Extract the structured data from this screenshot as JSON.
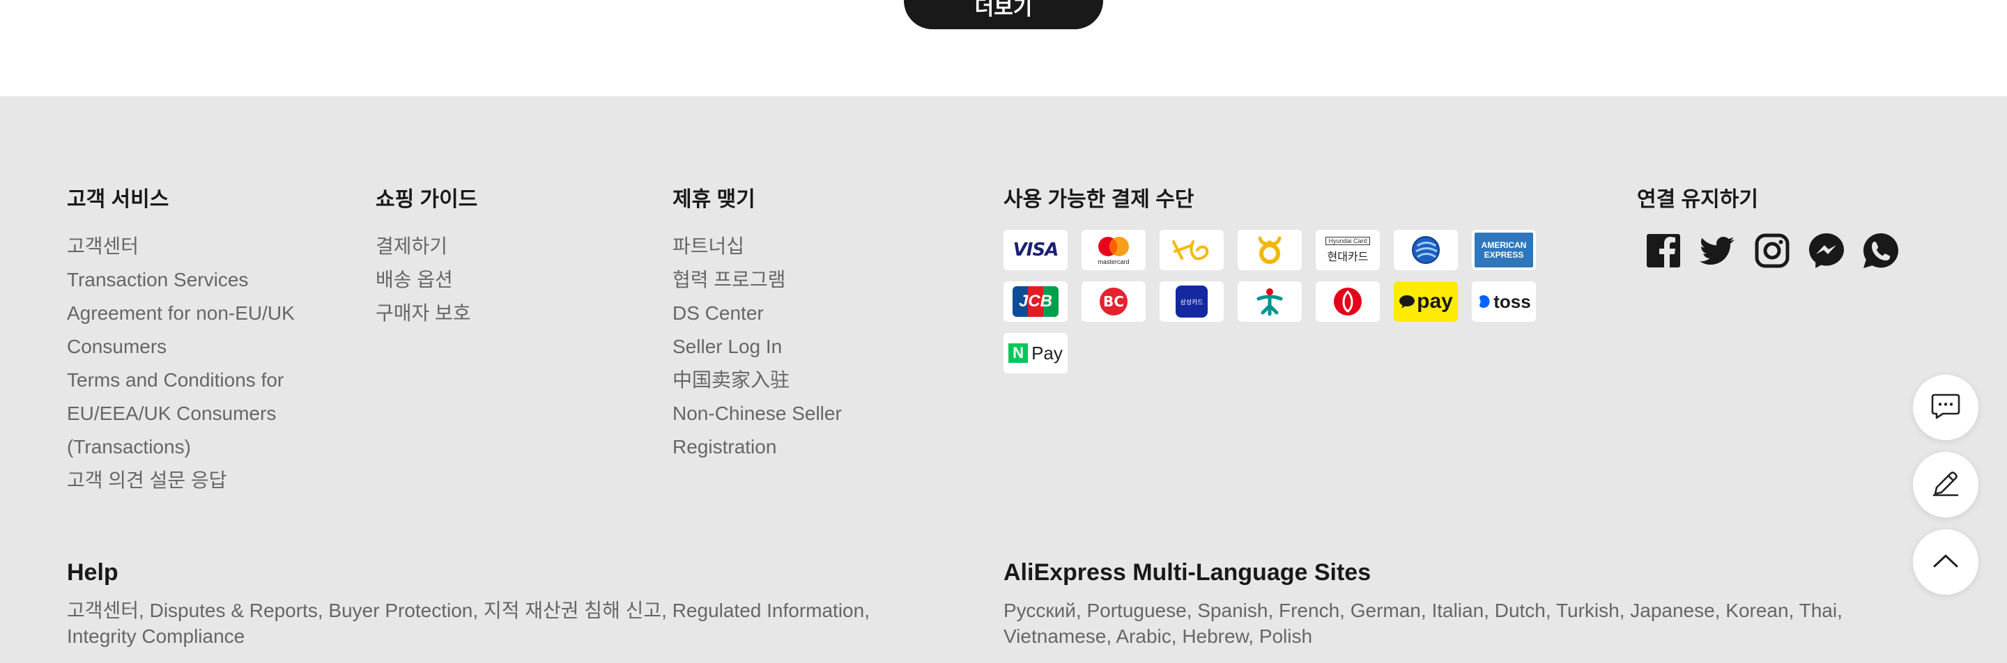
{
  "top": {
    "more_label": "더보기"
  },
  "customer_service": {
    "title": "고객 서비스",
    "items": [
      "고객센터",
      "Transaction Services",
      "Agreement for non-EU/UK",
      "Consumers",
      "Terms and Conditions for",
      "EU/EEA/UK Consumers",
      "(Transactions)",
      "고객 의견 설문 응답"
    ]
  },
  "shopping_guide": {
    "title": "쇼핑 가이드",
    "items": [
      "결제하기",
      "배송 옵션",
      "구매자 보호"
    ]
  },
  "partnership": {
    "title": "제휴 맺기",
    "items": [
      "파트너십",
      "협력 프로그램",
      "DS Center",
      "Seller Log In",
      "中国卖家入驻",
      "Non-Chinese Seller",
      "Registration"
    ]
  },
  "payment": {
    "title": "사용 가능한 결제 수단",
    "methods": [
      "visa",
      "mastercard",
      "kb",
      "nh",
      "hyundai",
      "shinhan",
      "amex",
      "jcb",
      "bc",
      "samsung",
      "hana",
      "lotte",
      "kakaopay",
      "toss",
      "naverpay"
    ],
    "labels": {
      "visa": "VISA",
      "mastercard": "mastercard",
      "hyundai_top": "Hyundai Card",
      "hyundai_bottom": "현대카드",
      "amex_top": "AMERICAN",
      "amex_bottom": "EXPRESS",
      "jcb": "JCB",
      "samsung": "삼성카드",
      "kakaopay": "pay",
      "toss": "toss",
      "naverpay_n": "N",
      "naverpay_pay": "Pay"
    }
  },
  "stay_connected": {
    "title": "연결 유지하기",
    "icons": [
      "facebook-icon",
      "twitter-icon",
      "instagram-icon",
      "messenger-icon",
      "whatsapp-icon"
    ]
  },
  "help": {
    "title": "Help",
    "line1": [
      "고객센터",
      "Disputes & Reports",
      "Buyer Protection",
      "지적 재산권 침해 신고",
      "Regulated Information"
    ],
    "line2": [
      "Integrity Compliance"
    ]
  },
  "multilang": {
    "title": "AliExpress Multi-Language Sites",
    "line1": [
      "Русский",
      "Portuguese",
      "Spanish",
      "French",
      "German",
      "Italian",
      "Dutch",
      "Turkish",
      "Japanese",
      "Korean",
      "Thai"
    ],
    "line2": [
      "Vietnamese",
      "Arabic",
      "Hebrew",
      "Polish"
    ]
  },
  "float_buttons": [
    "chat-icon",
    "edit-icon",
    "scroll-top-icon"
  ],
  "colors": {
    "footer_bg": "#e7e7e7",
    "heading": "#191919",
    "link": "#666666",
    "button_dark": "#191919"
  }
}
